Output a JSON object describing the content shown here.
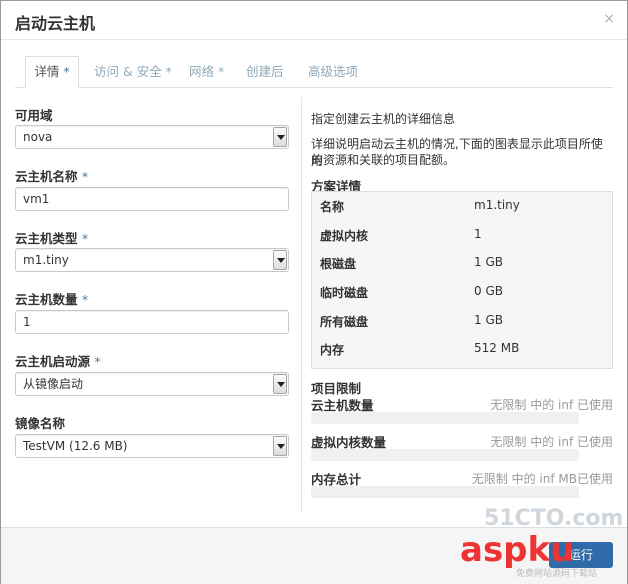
{
  "modal": {
    "title": "启动云主机",
    "close": "×"
  },
  "tabs": [
    {
      "label": "详情",
      "required": " *"
    },
    {
      "label": "访问 & 安全",
      "required": " *"
    },
    {
      "label": "网络",
      "required": " *"
    },
    {
      "label": "创建后",
      "required": ""
    },
    {
      "label": "高级选项",
      "required": ""
    }
  ],
  "form": {
    "availability_zone": {
      "label": "可用域",
      "value": "nova"
    },
    "instance_name": {
      "label": "云主机名称",
      "required": "*",
      "value": "vm1"
    },
    "flavor": {
      "label": "云主机类型",
      "required": "*",
      "value": "m1.tiny"
    },
    "count": {
      "label": "云主机数量",
      "required": "*",
      "value": "1"
    },
    "boot_source": {
      "label": "云主机启动源",
      "required": "*",
      "value": "从镜像启动"
    },
    "image": {
      "label": "镜像名称",
      "value": "TestVM (12.6 MB)"
    }
  },
  "info": {
    "intro_title": "指定创建云主机的详细信息",
    "intro_line1": "详细说明启动云主机的情况,下面的图表显示此项目所使用",
    "intro_line2": "的资源和关联的项目配额。"
  },
  "flavor_details": {
    "heading": "方案详情",
    "rows": [
      {
        "key": "名称",
        "value": "m1.tiny"
      },
      {
        "key": "虚拟内核",
        "value": "1"
      },
      {
        "key": "根磁盘",
        "value": "1 GB"
      },
      {
        "key": "临时磁盘",
        "value": "0 GB"
      },
      {
        "key": "所有磁盘",
        "value": "1 GB"
      },
      {
        "key": "内存",
        "value": "512 MB"
      }
    ]
  },
  "limits": {
    "heading": "项目限制",
    "items": [
      {
        "label": "云主机数量",
        "note": "无限制 中的 inf 已使用"
      },
      {
        "label": "虚拟内核数量",
        "note": "无限制 中的 inf 已使用"
      },
      {
        "label": "内存总计",
        "note": "无限制 中的 inf MB已使用"
      }
    ]
  },
  "footer": {
    "launch_label": "运行"
  },
  "watermark": {
    "line1": "51CTO.com",
    "line2": "aspku",
    "line3": "免费网站源码下载站"
  }
}
